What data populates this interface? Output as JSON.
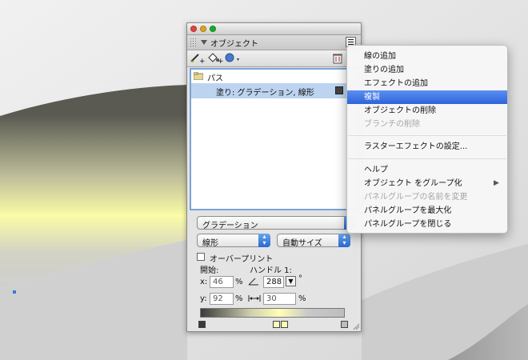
{
  "panel": {
    "tab_title": "オブジェクト",
    "tree": {
      "path_label": "パス",
      "fill_label": "塗り: グラデーション, 線形"
    },
    "gradient_type": "グラデーション",
    "style": "線形",
    "size_mode": "自動サイズ",
    "overprint_label": "オーバープリント",
    "start_label": "開始:",
    "handle_label": "ハンドル 1:",
    "x_label": "x:",
    "y_label": "y:",
    "x_value": "46",
    "y_value": "92",
    "pct": "%",
    "angle_value": "288",
    "degree": "°",
    "length_value": "30",
    "overprint_checked": false
  },
  "menu": {
    "items": [
      {
        "label": "線の追加",
        "disabled": false
      },
      {
        "label": "塗りの追加",
        "disabled": false
      },
      {
        "label": "エフェクトの追加",
        "disabled": false
      },
      {
        "label": "複製",
        "disabled": false,
        "selected": true
      },
      {
        "label": "オブジェクトの削除",
        "disabled": false
      },
      {
        "label": "ブランチの削除",
        "disabled": true
      },
      {
        "label": "ラスターエフェクトの設定...",
        "disabled": false
      },
      {
        "label": "ヘルプ",
        "disabled": false
      },
      {
        "label": "オブジェクト をグループ化",
        "disabled": false,
        "submenu": true
      },
      {
        "label": "パネルグループの名前を変更",
        "disabled": true
      },
      {
        "label": "パネルグループを最大化",
        "disabled": false
      },
      {
        "label": "パネルグループを閉じる",
        "disabled": false
      }
    ]
  },
  "colors": {
    "selection": "#2d63db",
    "list_border": "#7aa3d6",
    "row_highlight": "#bdd4f0",
    "close": "#e0443e",
    "minimize": "#dea123",
    "zoom": "#1aab29"
  },
  "icons": [
    "pen-plus-icon",
    "bucket-plus-icon",
    "effect-plus-icon",
    "trash-icon",
    "panel-menu-icon",
    "folder-icon",
    "fill-swatch-icon"
  ]
}
